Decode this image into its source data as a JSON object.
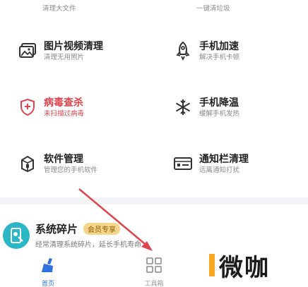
{
  "tools": [
    {
      "id": "clean-large-files",
      "sub": "清理大文件"
    },
    {
      "id": "clean-garbage",
      "sub": "一键清垃圾"
    },
    {
      "id": "photo-video",
      "title": "图片视频清理",
      "sub": "清理无用照片",
      "icon": "photo-icon"
    },
    {
      "id": "phone-speedup",
      "title": "手机加速",
      "sub": "解决手机卡顿",
      "icon": "rocket-icon"
    },
    {
      "id": "virus-scan",
      "title": "病毒查杀",
      "sub": "未扫描过病毒",
      "icon": "shield-icon",
      "alert": true
    },
    {
      "id": "phone-cooling",
      "title": "手机降温",
      "sub": "缓解手机发热",
      "icon": "snowflake-icon"
    },
    {
      "id": "software-manage",
      "title": "软件管理",
      "sub": "管理您的手机软件",
      "icon": "package-icon"
    },
    {
      "id": "notify-clean",
      "title": "通知栏清理",
      "sub": "远离通知打扰",
      "icon": "notification-icon"
    }
  ],
  "feature": {
    "title": "系统碎片",
    "badge": "会员专享",
    "sub": "经常清理系统碎片，延长手机寿命"
  },
  "tabbar": {
    "home": "首页",
    "toolbox": "工具箱"
  },
  "watermark": "微咖",
  "colors": {
    "accent_blue": "#2f6fde",
    "alert_red": "#e0434c",
    "teal": "#2bb7c6",
    "arrow_red": "#e0434c"
  }
}
